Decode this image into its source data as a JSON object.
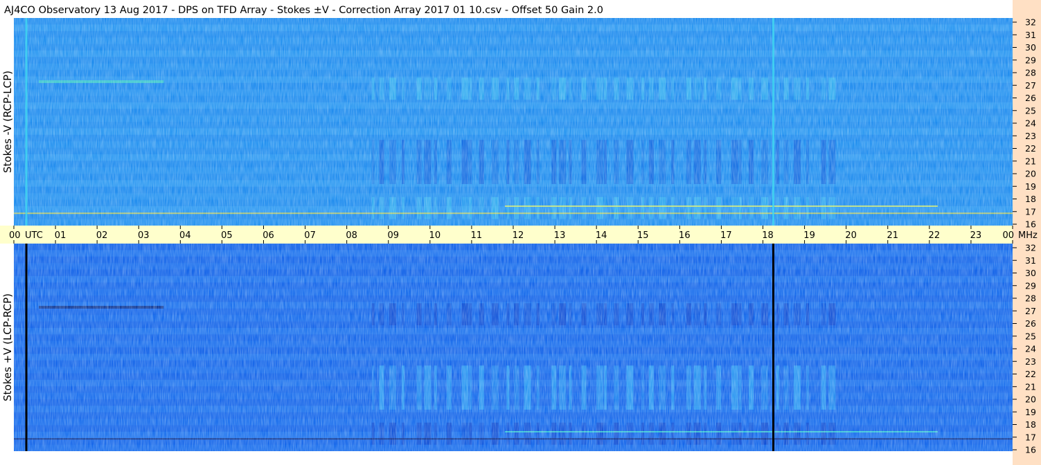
{
  "header": {
    "title": "AJ4CO Observatory  13 Aug 2017  -  DPS on TFD Array  -  Stokes ±V  -  Correction Array 2017 01 10.csv  -  Offset 50  Gain 2.0"
  },
  "chart_data": {
    "type": "heatmap",
    "title": "AJ4CO Observatory  13 Aug 2017  -  DPS on TFD Array  -  Stokes ±V  -  Correction Array 2017 01 10.csv  -  Offset 50  Gain 2.0",
    "x_axis": {
      "unit_label": "UTC",
      "ticks": [
        "00",
        "01",
        "02",
        "03",
        "04",
        "05",
        "06",
        "07",
        "08",
        "09",
        "10",
        "11",
        "12",
        "13",
        "14",
        "15",
        "16",
        "17",
        "18",
        "19",
        "20",
        "21",
        "22",
        "23",
        "00"
      ],
      "range_hours": [
        0,
        24
      ]
    },
    "y_axis": {
      "unit_label": "MHz",
      "ticks": [
        "16",
        "17",
        "18",
        "19",
        "20",
        "21",
        "22",
        "23",
        "24",
        "25",
        "26",
        "27",
        "28",
        "29",
        "30",
        "31",
        "32"
      ],
      "range_mhz": [
        16,
        32
      ]
    },
    "panels": [
      {
        "name": "Stokes -V (RCP-LCP)",
        "base_color": "#1e8ef0",
        "marker_lines_utc_hours": [
          0.3,
          18.25
        ],
        "marker_line_color": "#40d8f0"
      },
      {
        "name": "Stokes +V (LCP-RCP)",
        "base_color": "#1468ec",
        "marker_lines_utc_hours": [
          0.3,
          18.25
        ],
        "marker_line_color": "#000000"
      }
    ],
    "activity_window_utc_hours": [
      8.6,
      19.8
    ],
    "activity_bands_mhz": [
      [
        19.2,
        22.6
      ],
      [
        25.7,
        27.4
      ],
      [
        16.5,
        18.2
      ]
    ],
    "colors": {
      "time_axis_band": "#ffffcc",
      "freq_axis_band": "#ffe0c4",
      "axis_text": "#000000"
    },
    "legend": "none",
    "grid": false
  }
}
